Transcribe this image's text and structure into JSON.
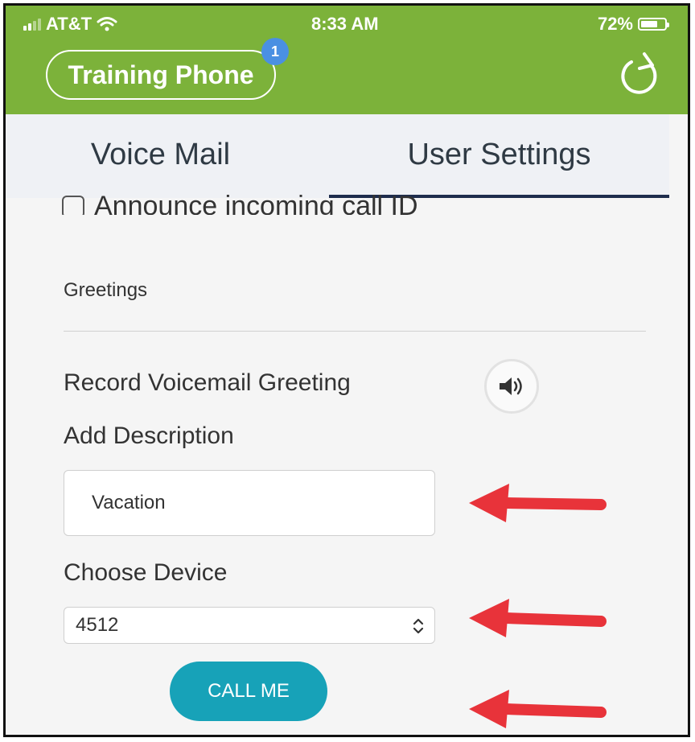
{
  "status_bar": {
    "carrier": "AT&T",
    "time": "8:33 AM",
    "battery_percent": "72%",
    "battery_level": 0.72,
    "signal_icon": "signal-icon",
    "wifi_icon": "wifi-icon"
  },
  "header": {
    "title": "Training Phone",
    "badge_count": "1",
    "refresh_icon": "refresh-icon",
    "color": "#7cb23a"
  },
  "tabs": [
    {
      "label": "Voice Mail",
      "active": false
    },
    {
      "label": "User Settings",
      "active": true
    }
  ],
  "settings": {
    "announce_checkbox_label": "Announce incoming call ID",
    "greetings_section": "Greetings",
    "record_greeting_label": "Record Voicemail Greeting",
    "speaker_icon": "speaker-icon",
    "add_description_label": "Add Description",
    "description_value": "Vacation",
    "choose_device_label": "Choose Device",
    "device_selected": "4512",
    "call_me_label": "CALL ME"
  },
  "colors": {
    "accent": "#17a2b8",
    "tab_indicator": "#1e2d4d",
    "annotation_arrow": "#e8333a"
  }
}
